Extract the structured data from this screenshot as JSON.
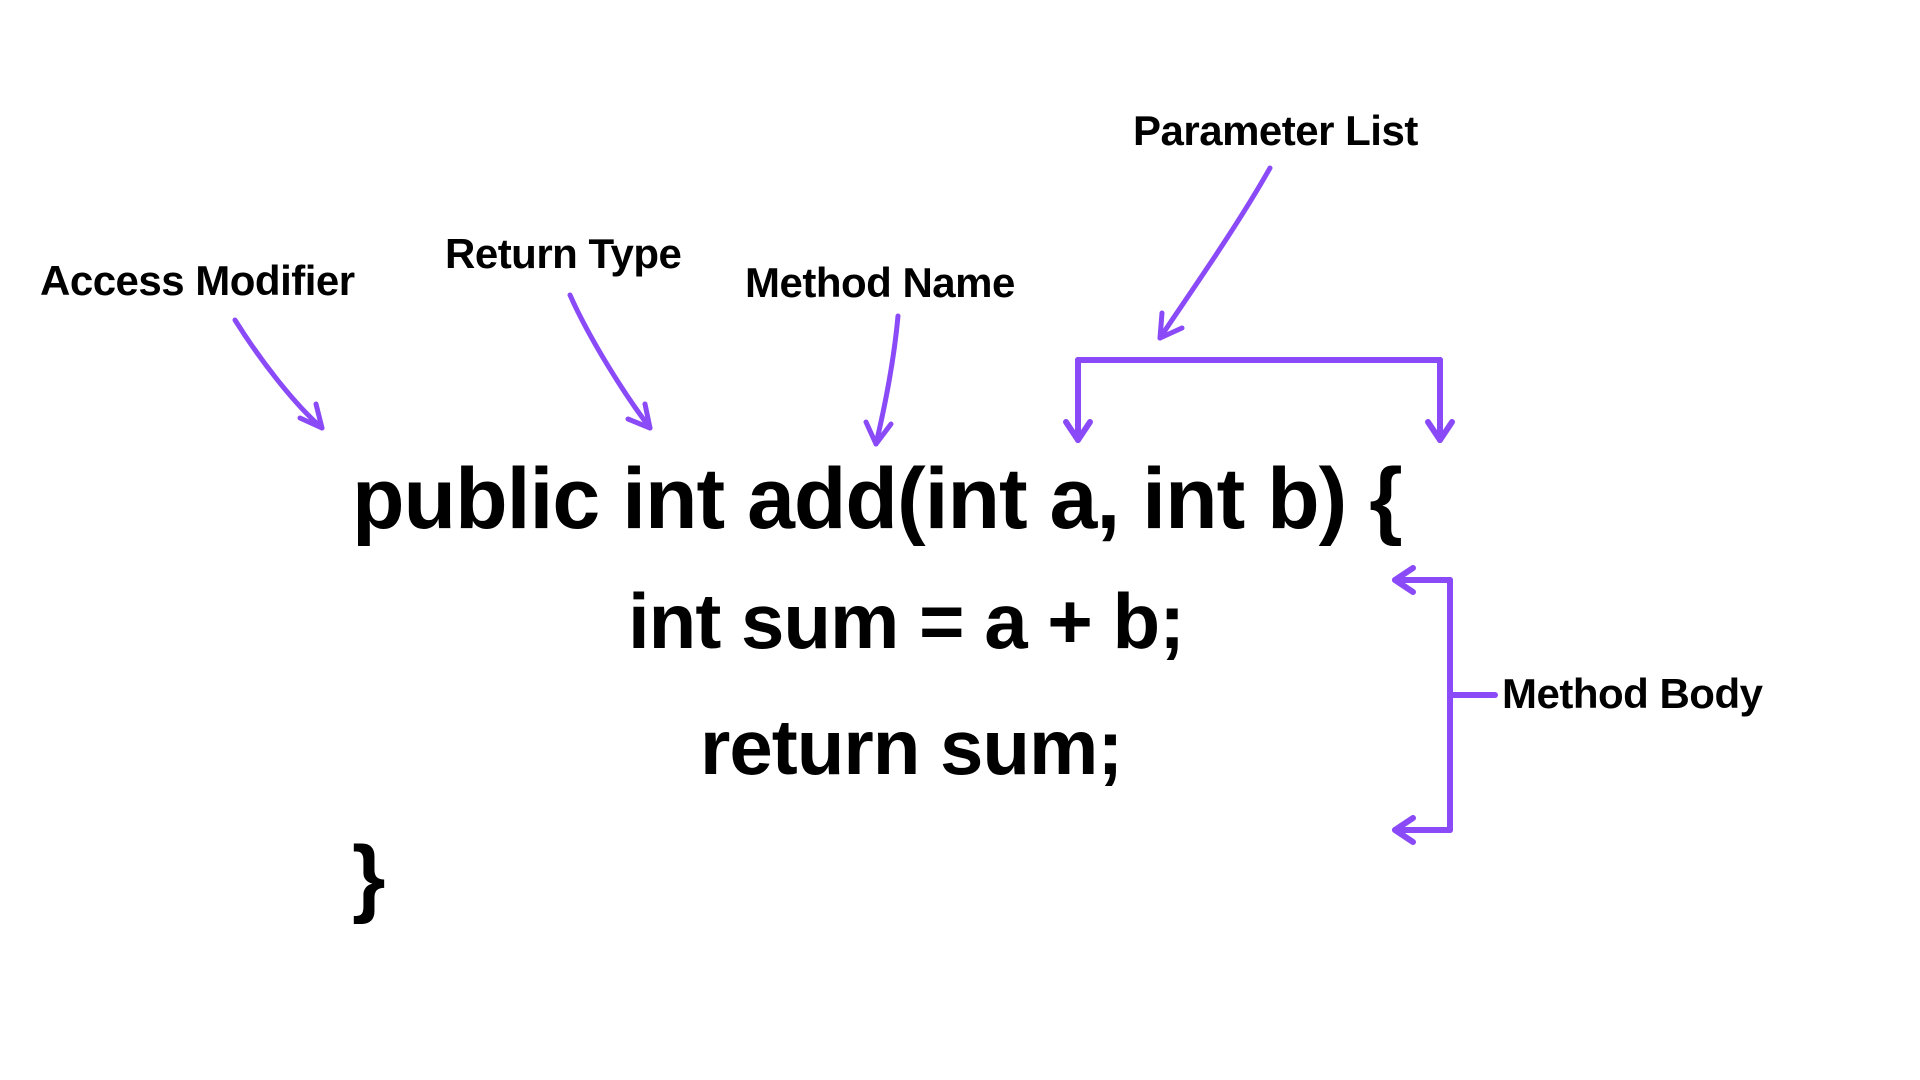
{
  "labels": {
    "access_modifier": "Access Modifier",
    "return_type": "Return Type",
    "method_name": "Method Name",
    "parameter_list": "Parameter List",
    "method_body": "Method Body"
  },
  "code": {
    "line1": "public int add(int a, int b) {",
    "line2": "int sum = a + b;",
    "line3": "return sum;",
    "line4": "}"
  },
  "colors": {
    "arrow": "#8a4af7",
    "text": "#000000"
  }
}
